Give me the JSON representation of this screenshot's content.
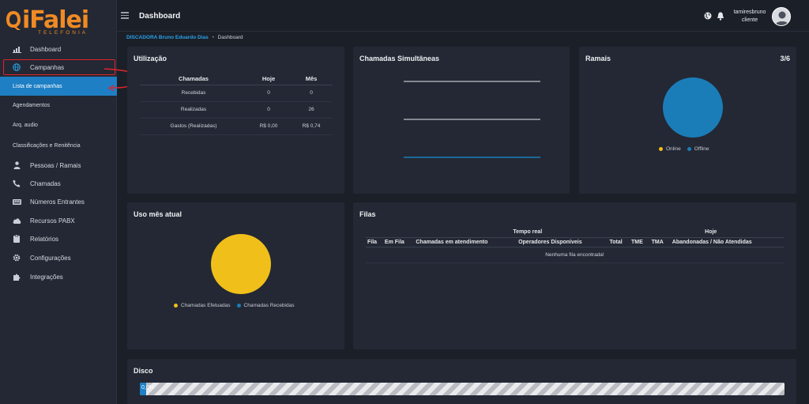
{
  "logo": {
    "brand": "iFalei",
    "tagline": "TELEFONIA"
  },
  "sidebar": {
    "items": [
      {
        "label": "Dashboard",
        "icon": "chart-icon"
      },
      {
        "label": "Campanhas",
        "icon": "globe-icon"
      },
      {
        "label": "Pessoas / Ramais",
        "icon": "person-icon"
      },
      {
        "label": "Chamadas",
        "icon": "phone-icon"
      },
      {
        "label": "Números Entrantes",
        "icon": "keypad-icon"
      },
      {
        "label": "Recursos PABX",
        "icon": "cloud-icon"
      },
      {
        "label": "Relatórios",
        "icon": "clipboard-icon"
      },
      {
        "label": "Configurações",
        "icon": "gear-icon"
      },
      {
        "label": "Integrações",
        "icon": "puzzle-icon"
      }
    ],
    "subitems": [
      {
        "label": "Lista de campanhas",
        "active": true
      },
      {
        "label": "Agendamentos"
      },
      {
        "label": "Arq. audio"
      },
      {
        "label": "Classificações e Renitência"
      }
    ]
  },
  "header": {
    "title": "Dashboard",
    "user_name": "tamiresbruno",
    "user_role": "cliente"
  },
  "breadcrumb": {
    "link": "DISCADORA Bruno Eduardo Dias",
    "separator": "•",
    "current": "Dashboard"
  },
  "utilizacao": {
    "title": "Utilização",
    "headers": [
      "Chamadas",
      "Hoje",
      "Mês"
    ],
    "rows": [
      [
        "Recebidas",
        "0",
        "0"
      ],
      [
        "Realizadas",
        "0",
        "26"
      ],
      [
        "Gastos (Realizadas)",
        "R$ 0,00",
        "R$ 0,74"
      ]
    ]
  },
  "chamadas_simultaneas": {
    "title": "Chamadas Simultâneas"
  },
  "ramais": {
    "title": "Ramais",
    "count": "3/6",
    "legend": [
      "Online",
      "Offline"
    ],
    "colors": {
      "online": "#f1bf1a",
      "offline": "#1b7db8"
    }
  },
  "uso_mes": {
    "title": "Uso mês atual",
    "legend": [
      "Chamadas Efetuadas",
      "Chamadas Recebidas"
    ],
    "colors": {
      "efetuadas": "#f1bf1a",
      "recebidas": "#1b7db8"
    }
  },
  "filas": {
    "title": "Filas",
    "group_realtime": "Tempo real",
    "group_today": "Hoje",
    "columns": [
      "Fila",
      "Em Fila",
      "Chamadas em atendimento",
      "Operadores Disponíveis",
      "Total",
      "TME",
      "TMA",
      "Abandonadas / Não Atendidas"
    ],
    "empty": "Nenhuma fila encontrada!"
  },
  "disco": {
    "title": "Disco",
    "usage_label": "0,0%",
    "usage_fraction": 0.01
  }
}
